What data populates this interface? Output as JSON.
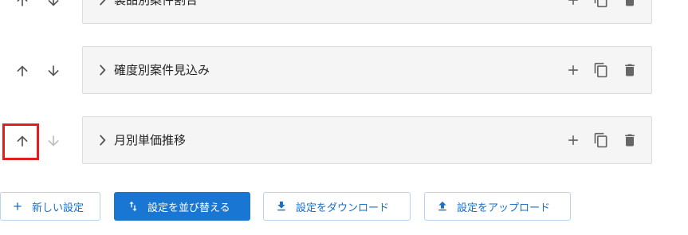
{
  "rows": [
    {
      "title": "製品別案件割合",
      "up_enabled": true,
      "down_enabled": true
    },
    {
      "title": "確度別案件見込み",
      "up_enabled": true,
      "down_enabled": true
    },
    {
      "title": "月別単価推移",
      "up_enabled": true,
      "down_enabled": false
    }
  ],
  "toolbar": {
    "new_label": "新しい設定",
    "sort_label": "設定を並び替える",
    "download_label": "設定をダウンロード",
    "upload_label": "設定をアップロード"
  },
  "colors": {
    "primary": "#1976d2",
    "highlight": "#e02020",
    "panel_bg": "#f5f5f5"
  },
  "icons": {
    "up": "arrow-up-icon",
    "down": "arrow-down-icon",
    "expand": "chevron-right-icon",
    "add": "plus-icon",
    "copy": "copy-icon",
    "delete": "trash-icon"
  }
}
